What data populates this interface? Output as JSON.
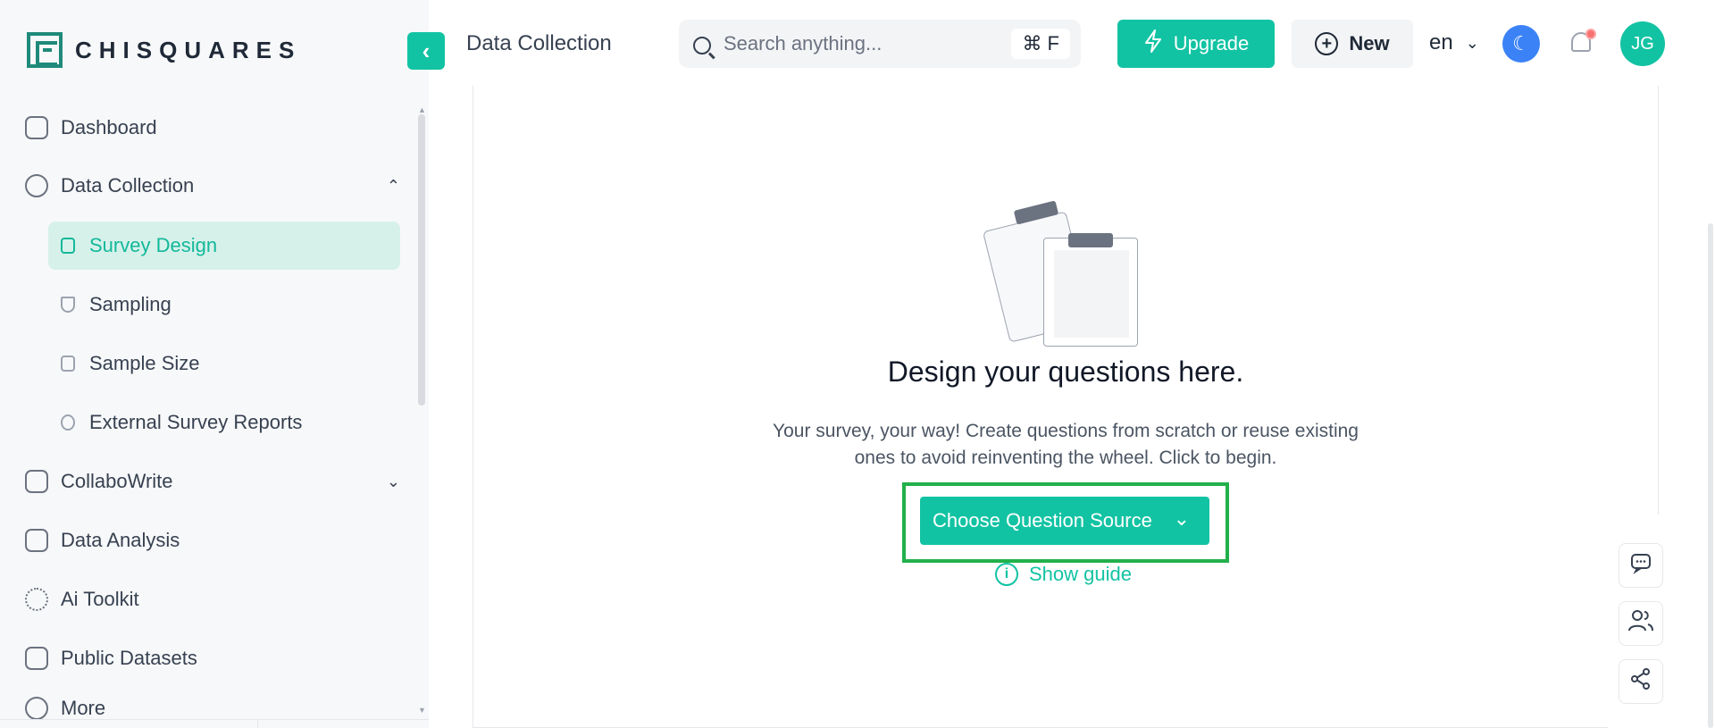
{
  "brand": {
    "name": "CHISQUARES"
  },
  "header": {
    "page_title": "Data Collection",
    "search_placeholder": "Search anything...",
    "search_shortcut": "⌘ F",
    "upgrade_label": "Upgrade",
    "new_label": "New",
    "language": "en",
    "avatar_initials": "JG"
  },
  "sidebar": {
    "items": [
      {
        "label": "Dashboard"
      },
      {
        "label": "Data Collection"
      },
      {
        "label": "CollaboWrite"
      },
      {
        "label": "Data Analysis"
      },
      {
        "label": "Ai Toolkit"
      },
      {
        "label": "Public Datasets"
      },
      {
        "label": "More"
      }
    ],
    "sub_items": [
      {
        "label": "Survey Design"
      },
      {
        "label": "Sampling"
      },
      {
        "label": "Sample Size"
      },
      {
        "label": "External Survey Reports"
      }
    ]
  },
  "main": {
    "empty_title": "Design your questions here.",
    "empty_desc": "Your survey, your way! Create questions from scratch or reuse existing ones to avoid reinventing the wheel. Click to begin.",
    "choose_label": "Choose Question Source",
    "guide_label": "Show guide"
  },
  "colors": {
    "accent": "#12c3a3",
    "highlight": "#22b04b",
    "theme_button": "#3b82f6"
  },
  "icons": [
    "search-icon",
    "lightning-icon",
    "plus-circle-icon",
    "moon-icon",
    "bell-icon",
    "chat-icon",
    "users-icon",
    "share-icon",
    "info-icon"
  ]
}
